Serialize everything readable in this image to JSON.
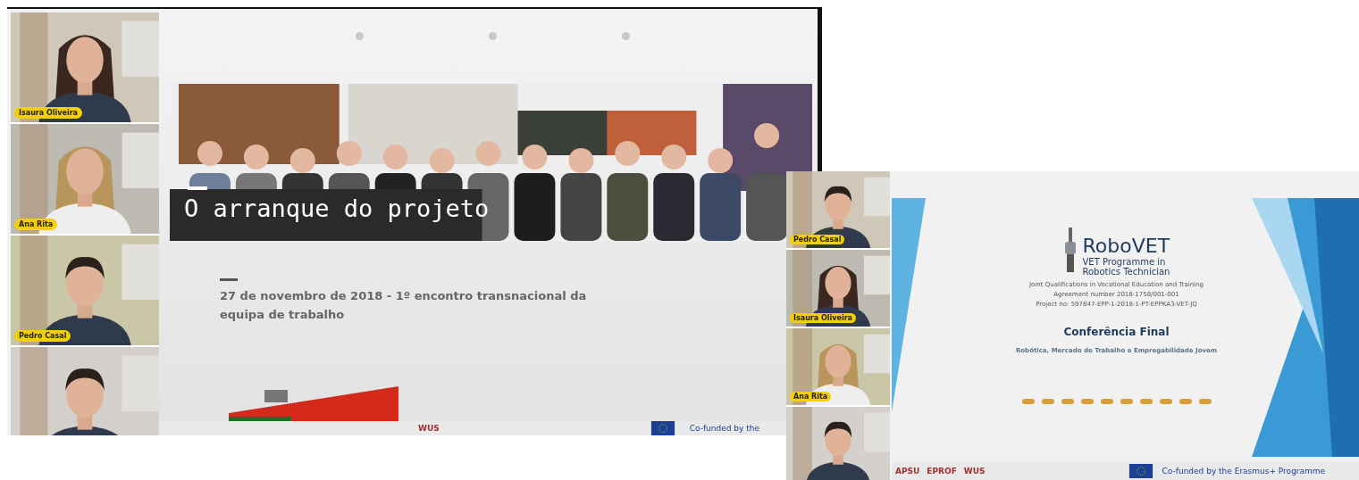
{
  "screens": [
    {
      "participants": [
        {
          "name": "Isaura Oliveira",
          "kind": "long-hair"
        },
        {
          "name": "Ana Rita",
          "kind": "blond"
        },
        {
          "name": "Pedro Casal",
          "kind": "short-hair"
        },
        {
          "kind": "short-hair"
        }
      ],
      "slide": {
        "kind": "photo-title",
        "title": "O arranque do projeto",
        "subtitle": "27 de novembro de 2018 - 1º encontro transnacional da equipa de trabalho",
        "footer": [
          {
            "kind": "text",
            "text": "WUS"
          },
          {
            "kind": "flag"
          },
          {
            "kind": "text",
            "text": "Co-funded by the"
          }
        ]
      }
    },
    {
      "participants": [
        {
          "name": "Pedro Casal",
          "kind": "short-hair"
        },
        {
          "name": "Isaura Oliveira",
          "kind": "long-hair"
        },
        {
          "name": "Ana Rita",
          "kind": "blond"
        },
        {
          "kind": "short-hair"
        }
      ],
      "slide": {
        "kind": "logo-title",
        "brand": "RoboVET",
        "tagline": "VET Programme in Robotics Technician",
        "lines": [
          "Joint Qualifications in Vocational Education and Training",
          "Agreement number 2018-1758/001-001",
          "Project no: 597847-EPP-1-2018-1-PT-EPPKA3-VET-JQ"
        ],
        "title": "Conferência Final",
        "subtitle": "Robótica, Mercado de Trabalho e Empregabilidade Jovem",
        "footer": [
          {
            "kind": "text",
            "text": "APSU"
          },
          {
            "kind": "text",
            "text": "EPROF"
          },
          {
            "kind": "text",
            "text": "WUS"
          },
          {
            "kind": "flag"
          },
          {
            "kind": "text",
            "text": "Co-funded by the Erasmus+ Programme"
          }
        ]
      }
    }
  ]
}
